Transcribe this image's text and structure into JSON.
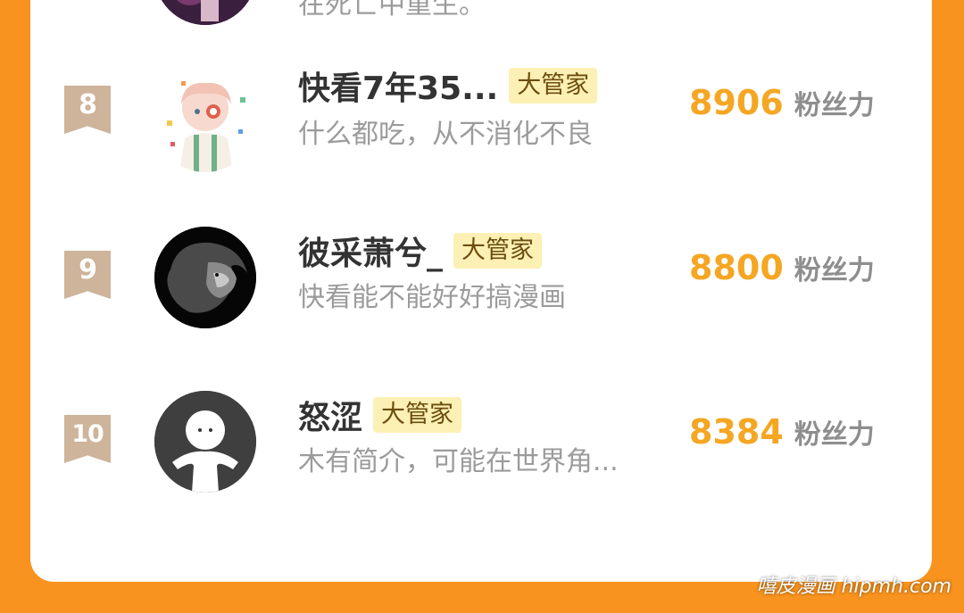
{
  "top_partial": {
    "bio": "在死亡中重生。"
  },
  "ranking": [
    {
      "rank": "8",
      "name": "快看7年35...",
      "tag": "大管家",
      "bio": "什么都吃，从不消化不良",
      "score": "8906",
      "score_unit": "粉丝力",
      "avatar": "anime-avatar-icon"
    },
    {
      "rank": "9",
      "name": "彼采萧兮_",
      "tag": "大管家",
      "bio": "快看能不能好好搞漫画",
      "score": "8800",
      "score_unit": "粉丝力",
      "avatar": "lion-avatar-icon"
    },
    {
      "rank": "10",
      "name": "怒涩",
      "tag": "大管家",
      "bio": "木有简介，可能在世界角...",
      "score": "8384",
      "score_unit": "粉丝力",
      "avatar": "default-avatar-icon"
    }
  ],
  "watermark": "嘻皮漫画 hipmh.com",
  "colors": {
    "background": "#f7931e",
    "score": "#f5a623",
    "tag_bg": "#fdf0b4",
    "rank_badge": "#cdb49a"
  }
}
